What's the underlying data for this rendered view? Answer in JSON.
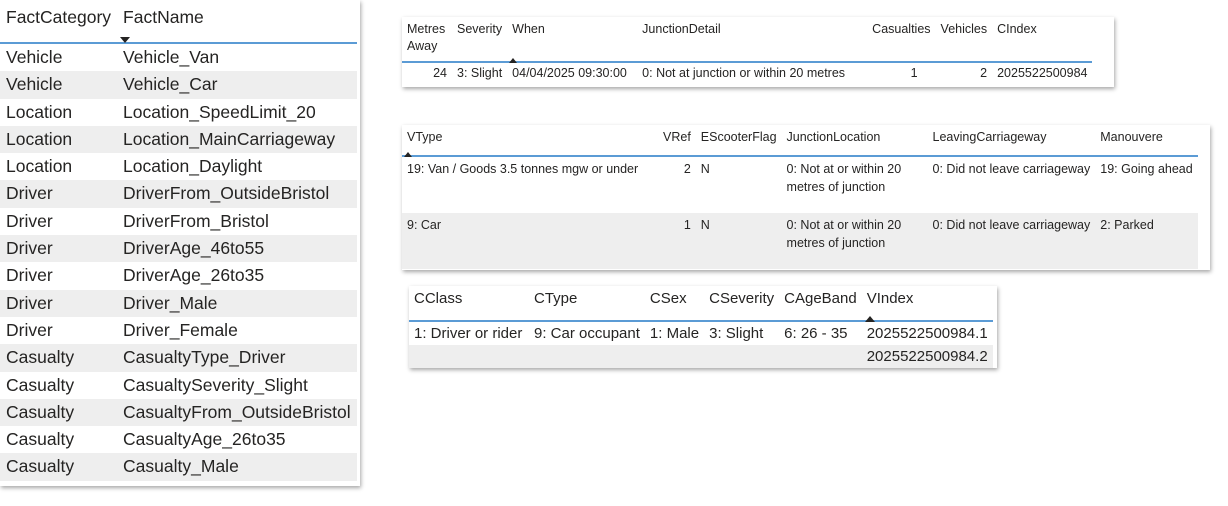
{
  "facts": {
    "headers": [
      "FactCategory",
      "FactName"
    ],
    "rows": [
      [
        "Vehicle",
        "Vehicle_Van"
      ],
      [
        "Vehicle",
        "Vehicle_Car"
      ],
      [
        "Location",
        "Location_SpeedLimit_20"
      ],
      [
        "Location",
        "Location_MainCarriageway"
      ],
      [
        "Location",
        "Location_Daylight"
      ],
      [
        "Driver",
        "DriverFrom_OutsideBristol"
      ],
      [
        "Driver",
        "DriverFrom_Bristol"
      ],
      [
        "Driver",
        "DriverAge_46to55"
      ],
      [
        "Driver",
        "DriverAge_26to35"
      ],
      [
        "Driver",
        "Driver_Male"
      ],
      [
        "Driver",
        "Driver_Female"
      ],
      [
        "Casualty",
        "CasualtyType_Driver"
      ],
      [
        "Casualty",
        "CasualtySeverity_Slight"
      ],
      [
        "Casualty",
        "CasualtyFrom_OutsideBristol"
      ],
      [
        "Casualty",
        "CasualtyAge_26to35"
      ],
      [
        "Casualty",
        "Casualty_Male"
      ]
    ]
  },
  "collision": {
    "headers": [
      "Metres Away",
      "Severity",
      "When",
      "JunctionDetail",
      "Casualties",
      "Vehicles",
      "CIndex"
    ],
    "row": [
      "24",
      "3: Slight",
      "04/04/2025 09:30:00",
      "0: Not at junction or within 20 metres",
      "1",
      "2",
      "2025522500984"
    ]
  },
  "vehicles": {
    "headers": [
      "VType",
      "VRef",
      "EScooterFlag",
      "JunctionLocation",
      "LeavingCarriageway",
      "Manouvere"
    ],
    "rows": [
      [
        "19: Van / Goods 3.5 tonnes mgw or under",
        "2",
        "N",
        "0: Not at or within 20 metres of junction",
        "0: Did not leave carriageway",
        "19: Going ahead"
      ],
      [
        "9: Car",
        "1",
        "N",
        "0: Not at or within 20 metres of junction",
        "0: Did not leave carriageway",
        "2: Parked"
      ]
    ]
  },
  "casualties": {
    "headers": [
      "CClass",
      "CType",
      "CSex",
      "CSeverity",
      "CAgeBand",
      "VIndex"
    ],
    "rows": [
      [
        "1: Driver or rider",
        "9: Car occupant",
        "1: Male",
        "3: Slight",
        "6: 26 - 35",
        "2025522500984.1"
      ],
      [
        "",
        "",
        "",
        "",
        "",
        "2025522500984.2"
      ]
    ]
  }
}
